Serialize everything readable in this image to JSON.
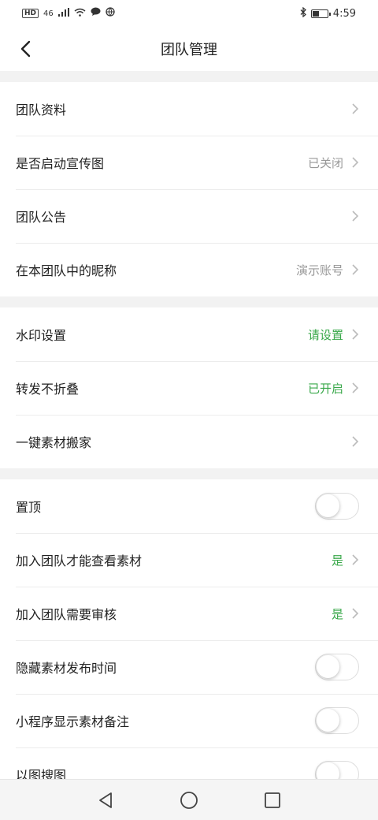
{
  "status": {
    "hd": "HD",
    "net": "46",
    "time": "4:59"
  },
  "header": {
    "title": "团队管理"
  },
  "groups": [
    {
      "items": [
        {
          "label": "团队资料",
          "value": ""
        },
        {
          "label": "是否启动宣传图",
          "value": "已关闭"
        },
        {
          "label": "团队公告",
          "value": ""
        },
        {
          "label": "在本团队中的昵称",
          "value": "演示账号"
        }
      ]
    },
    {
      "items": [
        {
          "label": "水印设置",
          "value": "请设置"
        },
        {
          "label": "转发不折叠",
          "value": "已开启"
        },
        {
          "label": "一键素材搬家",
          "value": ""
        }
      ]
    },
    {
      "items": [
        {
          "label": "置顶",
          "toggle": false
        },
        {
          "label": "加入团队才能查看素材",
          "value": "是"
        },
        {
          "label": "加入团队需要审核",
          "value": "是"
        },
        {
          "label": "隐藏素材发布时间",
          "toggle": false
        },
        {
          "label": "小程序显示素材备注",
          "toggle": false
        },
        {
          "label": "以图搜图",
          "toggle": false
        }
      ]
    }
  ],
  "colors": {
    "accent_green": "#39a84a",
    "muted": "#999999"
  }
}
